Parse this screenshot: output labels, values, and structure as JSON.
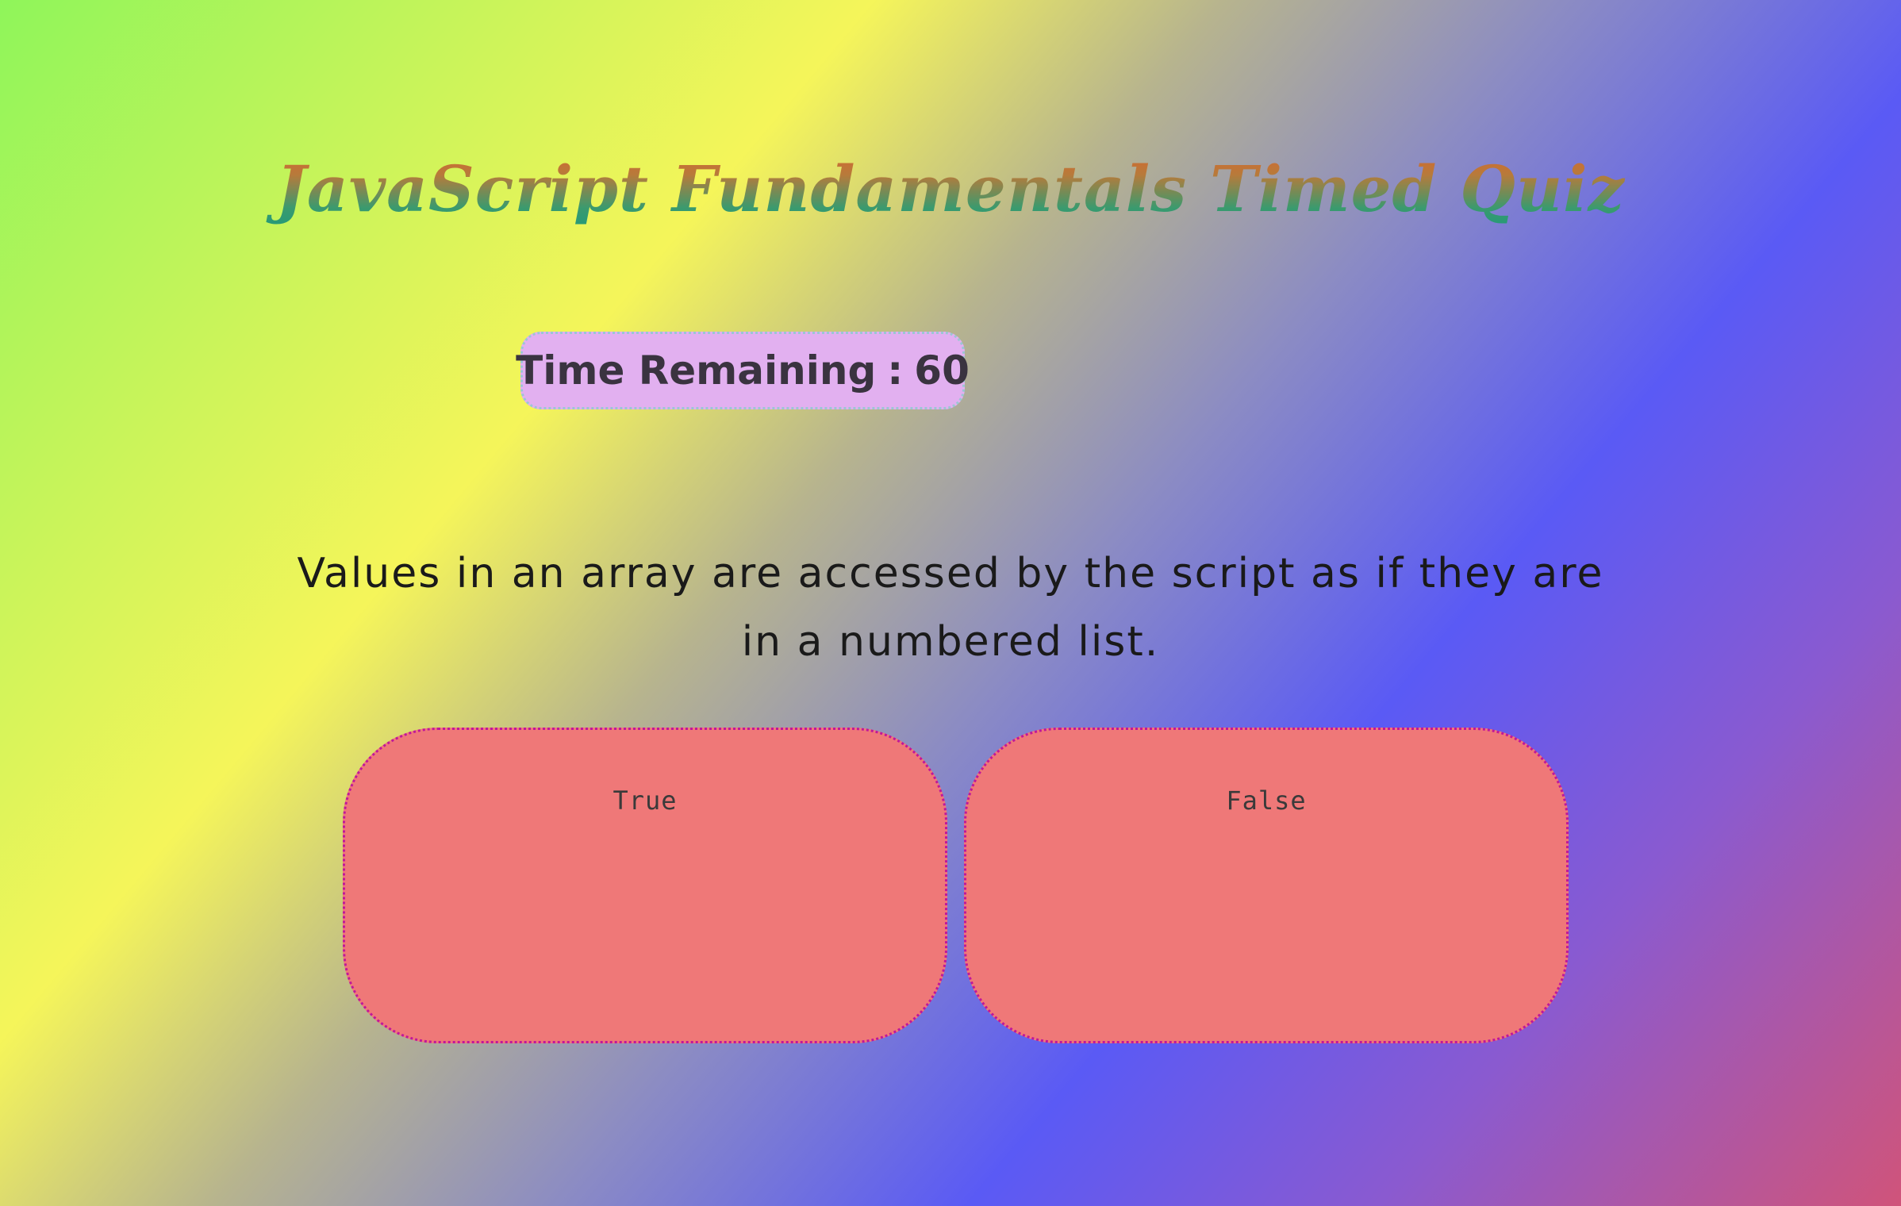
{
  "quiz": {
    "title": "JavaScript Fundamentals Timed Quiz",
    "timer": {
      "label": "Time Remaining",
      "separator": ":",
      "value": "60"
    },
    "question": "Values in an array are accessed by the script as if they are in a numbered list.",
    "answers": [
      {
        "label": "True"
      },
      {
        "label": "False"
      }
    ]
  },
  "colors": {
    "answer_background": "#ef7878",
    "answer_border": "#c0179a",
    "timer_background": "#e2b0f0"
  }
}
